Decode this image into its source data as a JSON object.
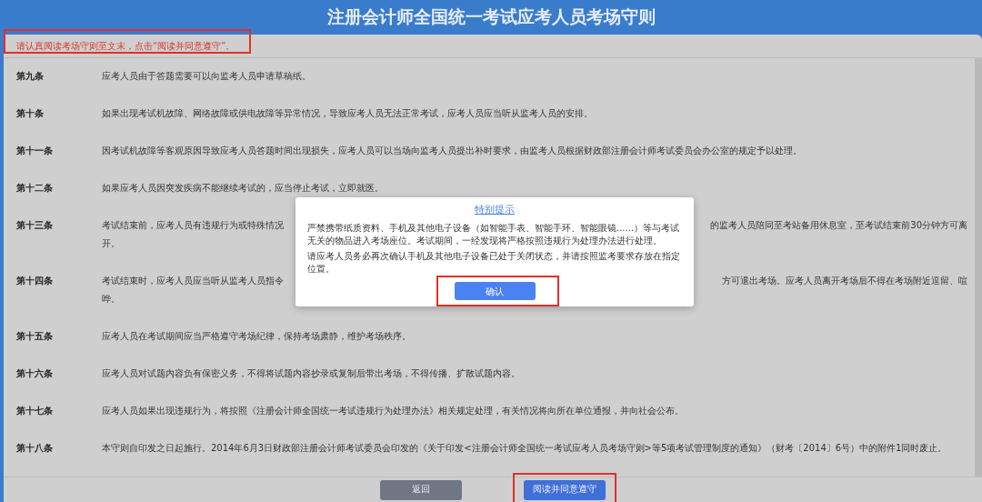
{
  "header": {
    "title": "注册会计师全国统一考试应考人员考场守则"
  },
  "notice": {
    "text": "请认真阅读考场守则至文末，点击“阅读并同意遵守”。",
    "highlighted": true
  },
  "rules": [
    {
      "kind": "plain",
      "label": "第九条",
      "text": "应考人员由于答题需要可以向监考人员申请草稿纸。"
    },
    {
      "kind": "plain",
      "label": "第十条",
      "text": "如果出现考试机故障、网络故障或供电故障等异常情况，导致应考人员无法正常考试，应考人员应当听从监考人员的安排。"
    },
    {
      "kind": "plain",
      "label": "第十一条",
      "text": "因考试机故障等客观原因导致应考人员答题时间出现损失，应考人员可以当场向监考人员提出补时要求，由监考人员根据财政部注册会计师考试委员会办公室的规定予以处理。"
    },
    {
      "kind": "plain",
      "label": "第十二条",
      "text": "如果应考人员因突发疾病不能继续考试的，应当停止考试，立即就医。"
    },
    {
      "kind": "split",
      "label": "第十三条",
      "text_left": "考试结束前，应考人员有违规行为或特殊情况",
      "text_right": "的监考人员陪同至考站备用休息室，至考试结束前30分钟方可离",
      "text_continued": "开。"
    },
    {
      "kind": "split",
      "label": "第十四条",
      "text_left": "考试结束时，应考人员应当听从监考人员指令",
      "text_right": "方可退出考场。应考人员离开考场后不得在考场附近逗留、喧",
      "text_continued": "哗。"
    },
    {
      "kind": "plain",
      "label": "第十五条",
      "text": "应考人员在考试期间应当严格遵守考场纪律，保持考场肃静，维护考场秩序。"
    },
    {
      "kind": "plain",
      "label": "第十六条",
      "text": "应考人员对试题内容负有保密义务，不得将试题内容抄录或复制后带出考场，不得传播、扩散试题内容。"
    },
    {
      "kind": "plain",
      "label": "第十七条",
      "text": "应考人员如果出现违规行为，将按照《注册会计师全国统一考试违规行为处理办法》相关规定处理，有关情况将向所在单位通报，并向社会公布。"
    },
    {
      "kind": "plain",
      "label": "第十八条",
      "text": "本守则自印发之日起施行。2014年6月3日财政部注册会计师考试委员会印发的《关于印发<注册会计师全国统一考试应考人员考场守则>等5项考试管理制度的通知》（财考〔2014〕6号）中的附件1同时废止。"
    }
  ],
  "buttons": [
    {
      "label": "返回",
      "kind": "secondary",
      "highlighted": false
    },
    {
      "label": "阅读并同意遵守",
      "kind": "primary",
      "highlighted": true
    }
  ],
  "dialog": {
    "title": "特别提示",
    "paragraphs": [
      "严禁携带纸质资料、手机及其他电子设备（如智能手表、智能手环、智能眼镜......）等与考试无关的物品进入考场座位。考试期间，一经发现将严格按照违规行为处理办法进行处理。",
      "请应考人员务必再次确认手机及其他电子设备已处于关闭状态，并请按照监考要求存放在指定位置。"
    ],
    "button": {
      "label": "确认",
      "highlighted": true
    }
  }
}
